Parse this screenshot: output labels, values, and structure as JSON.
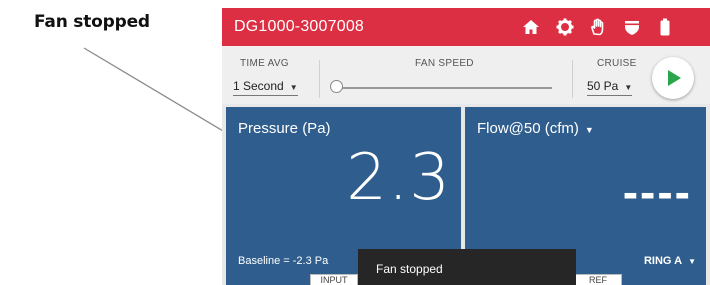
{
  "callout": {
    "text": "Fan stopped"
  },
  "device": {
    "title": "DG1000-3007008",
    "accent_color": "#dc2f43",
    "panel_color": "#2f5e8e",
    "icons": [
      "home-icon",
      "gear-icon",
      "hand-icon",
      "shield-icon",
      "battery-icon"
    ]
  },
  "controls": {
    "time_avg_label": "TIME AVG",
    "time_avg_value": "1 Second",
    "fan_speed_label": "FAN SPEED",
    "fan_speed_level": 0,
    "cruise_label": "CRUISE",
    "cruise_value": "50 Pa",
    "play_icon": "play-icon"
  },
  "pressure_panel": {
    "title": "Pressure (Pa)",
    "value": "2.3",
    "baseline": "Baseline = -2.3 Pa"
  },
  "flow_panel": {
    "title": "Flow@50 (cfm)",
    "value": "----",
    "ring": "RING A"
  },
  "bottom_tabs": [
    "INPUT",
    "REF"
  ],
  "toast": {
    "message": "Fan stopped"
  }
}
